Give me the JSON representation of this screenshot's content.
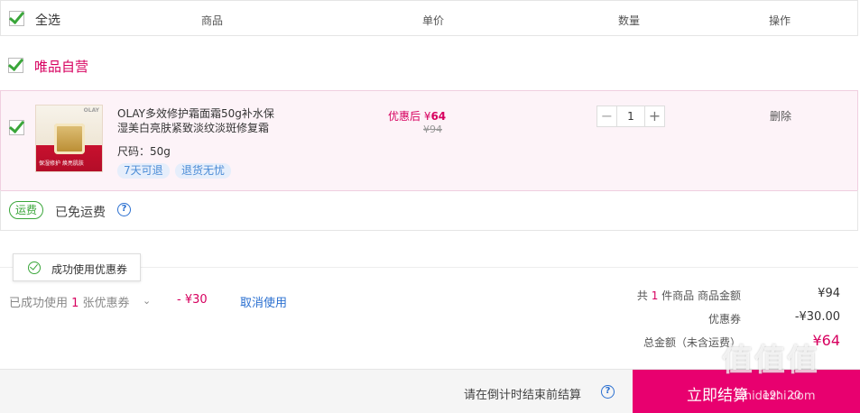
{
  "header": {
    "select_all": "全选",
    "col_product": "商品",
    "col_price": "单价",
    "col_qty": "数量",
    "col_action": "操作"
  },
  "store": {
    "name": "唯品自营"
  },
  "item": {
    "title": "OLAY多效修护霜面霜50g补水保湿美白亮肤紧致淡纹淡斑修复霜",
    "thumb_brand": "OLAY",
    "thumb_tag": "保湿修护 焕亮肌肤",
    "size": "尺码：50g",
    "badges": [
      "7天可退",
      "退货无忧"
    ],
    "price_prefix": "优惠后 ¥",
    "price_now": "64",
    "price_old": "¥94",
    "qty": "1",
    "minus": "−",
    "plus": "+",
    "delete": "删除"
  },
  "shipping": {
    "tag": "运费",
    "text": "已免运费",
    "help": "?"
  },
  "coupon": {
    "tooltip": "成功使用优惠券",
    "line_prefix": "已成功使用 ",
    "line_count": "1",
    "line_suffix": " 张优惠券",
    "chevron": "⌄",
    "amount": "- ¥30",
    "cancel": "取消使用"
  },
  "summary": {
    "count_prefix": "共 ",
    "count": "1",
    "count_suffix": " 件商品  商品金额",
    "goods_amount": "¥94",
    "discount_label": "优惠券",
    "discount_amount": "-¥30.00",
    "total_label": "总金额（未含运费）",
    "total_amount": "¥64"
  },
  "footer": {
    "countdown": "请在倒计时结束前结算",
    "help": "?",
    "checkout": "立即结算",
    "timer": "19：20"
  },
  "watermark": {
    "main": "值值值",
    "sub": "zhidezhi.com"
  },
  "colors": {
    "accent": "#e8006f",
    "brand": "#d7005f",
    "check": "#3aa63a",
    "link": "#2a6fd0"
  }
}
